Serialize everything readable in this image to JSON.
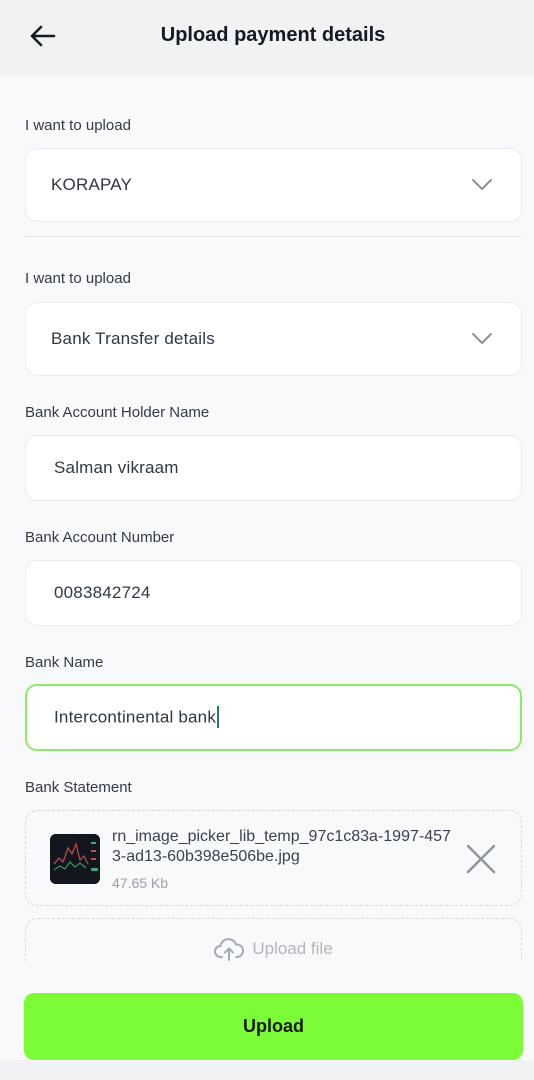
{
  "header": {
    "title": "Upload payment details"
  },
  "form": {
    "upload_type_1": {
      "label": "I want to upload",
      "value": "KORAPAY"
    },
    "upload_type_2": {
      "label": "I want to upload",
      "value": "Bank Transfer details"
    },
    "holder_name": {
      "label": "Bank Account Holder Name",
      "value": "Salman vikraam"
    },
    "account_number": {
      "label": "Bank Account Number",
      "value": "0083842724"
    },
    "bank_name": {
      "label": "Bank Name",
      "value": "Intercontinental bank"
    },
    "statement": {
      "label": "Bank Statement",
      "file_name": "rn_image_picker_lib_temp_97c1c83a-1997-4573-ad13-60b398e506be.jpg",
      "file_size": "47.65 Kb",
      "upload_label": "Upload file"
    }
  },
  "actions": {
    "upload_label": "Upload"
  },
  "colors": {
    "accent": "#7bfc37",
    "active_border": "#8ee86a"
  },
  "icons": {
    "back": "arrow-left-icon",
    "chevron": "chevron-down-icon",
    "remove": "close-icon",
    "upload": "cloud-upload-icon"
  }
}
